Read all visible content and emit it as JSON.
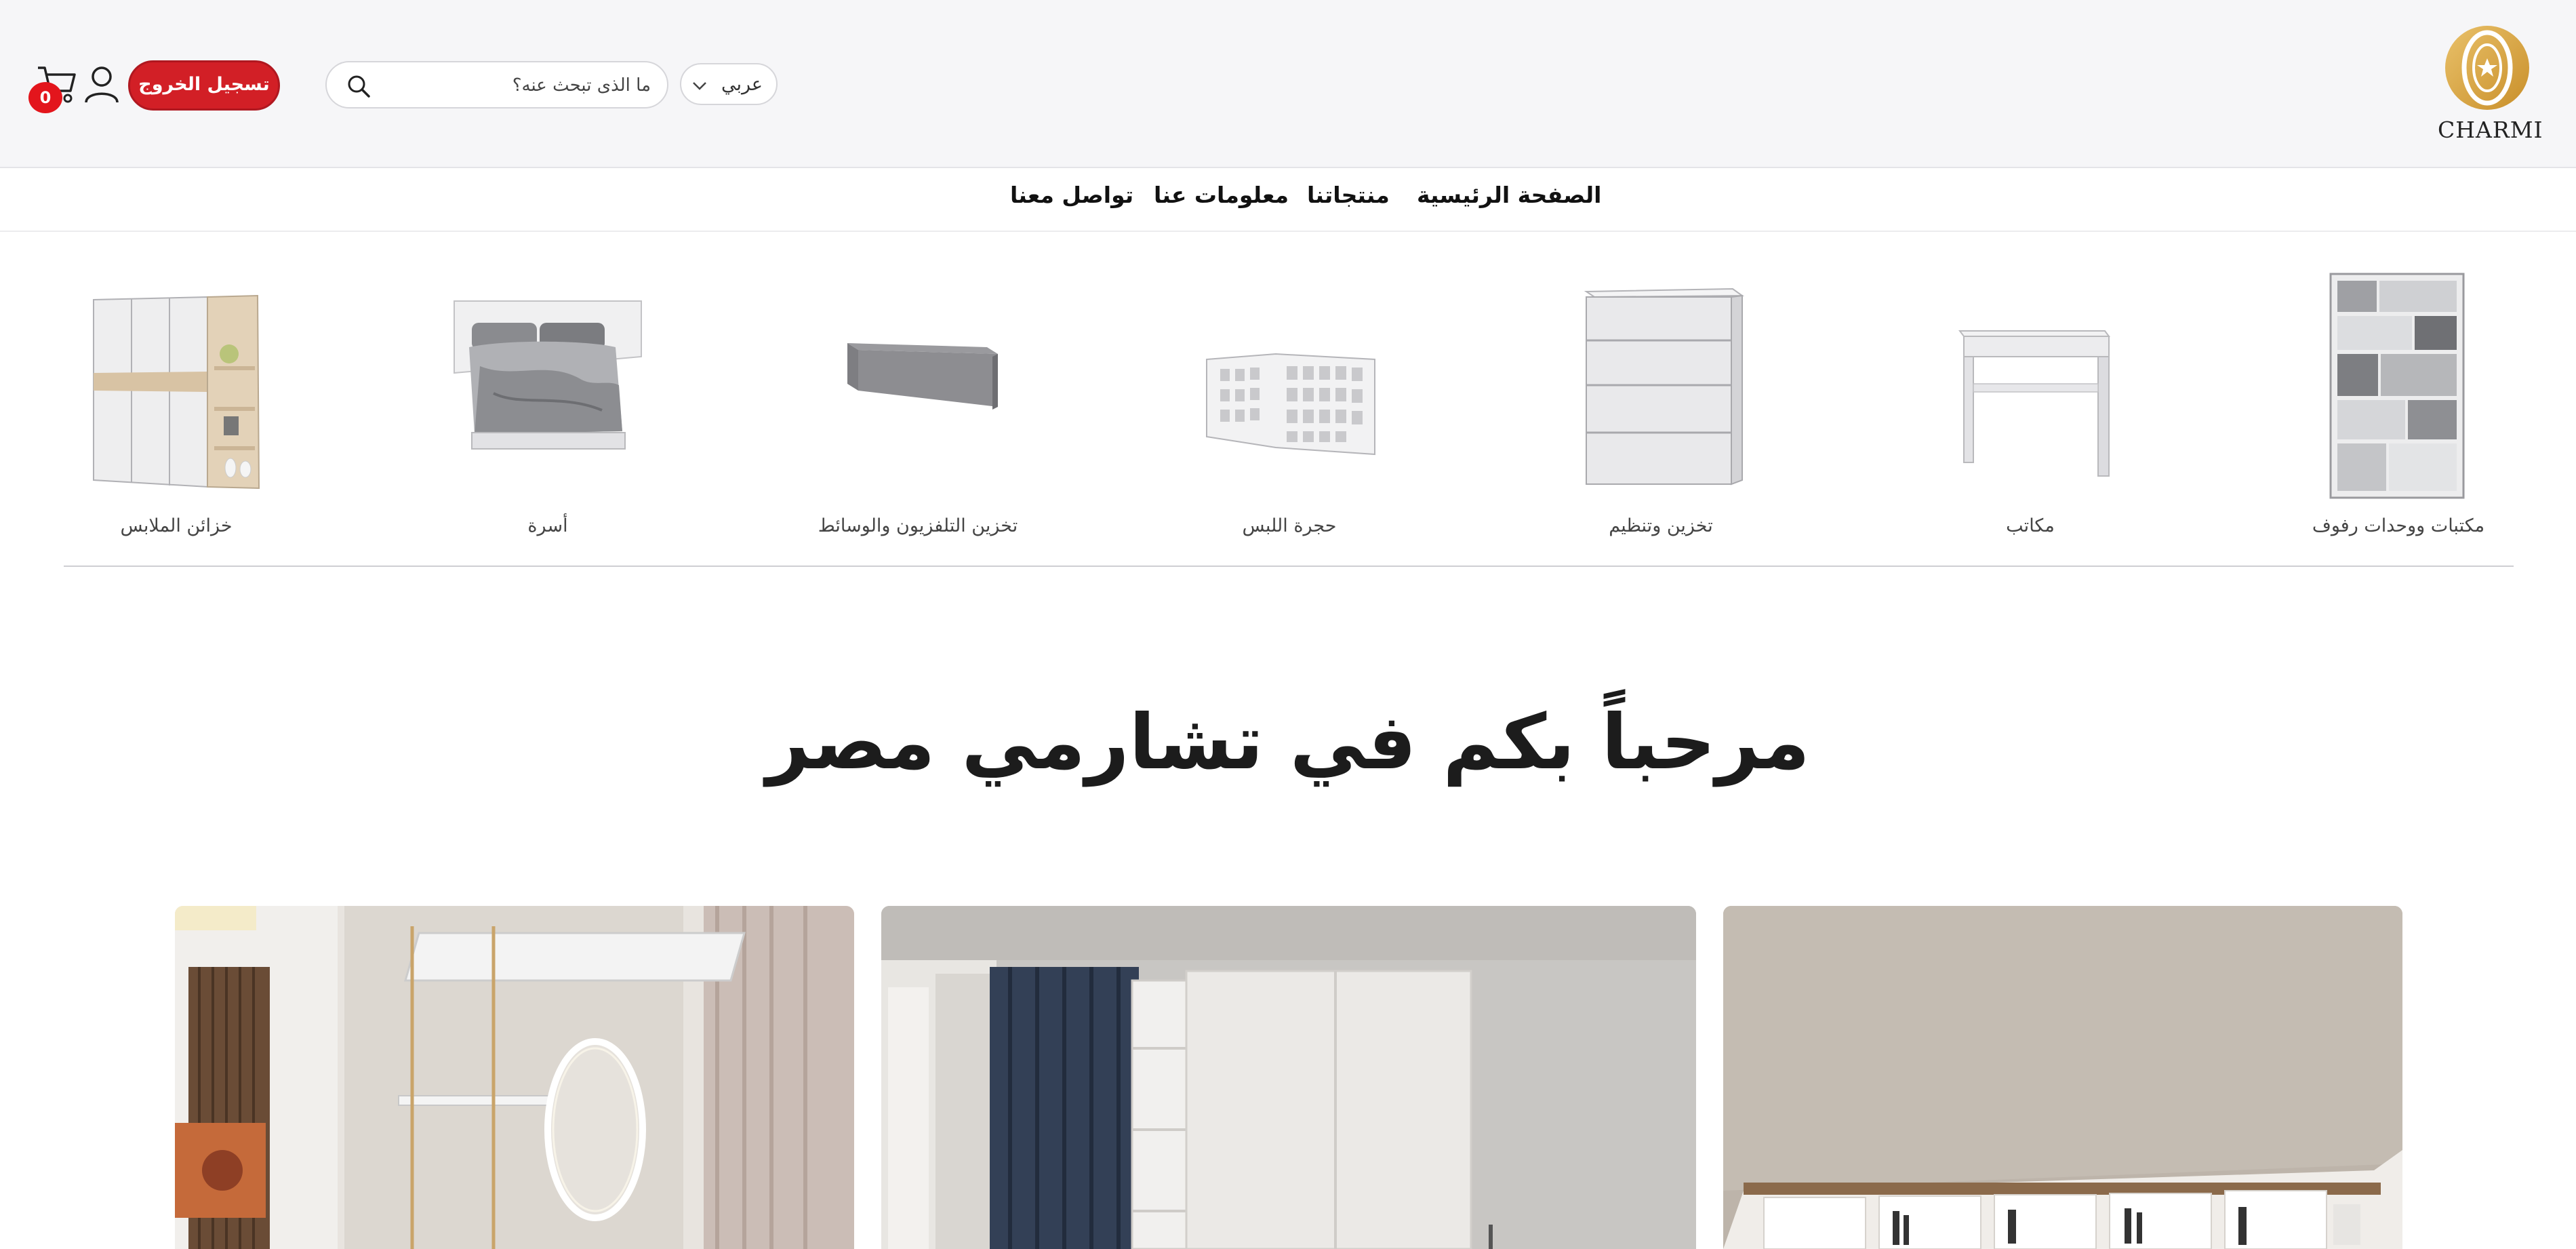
{
  "header": {
    "logo_text": "CHARMI",
    "language": {
      "selected": "عربي"
    },
    "search": {
      "placeholder": "ما الذى تبحث عنه؟",
      "value": ""
    },
    "logout_label": "تسجيل الخروج",
    "cart_count": "0",
    "brand_color": "#d21f26",
    "logo_color": "#d8a33c"
  },
  "nav": {
    "items": [
      {
        "label": "الصفحة الرئيسية"
      },
      {
        "label": "منتجاتنا"
      },
      {
        "label": "معلومات عنا"
      },
      {
        "label": "تواصل معنا"
      }
    ]
  },
  "categories": [
    {
      "label": "مكتبات ووحدات رفوف",
      "icon": "bookcase-image"
    },
    {
      "label": "مكاتب",
      "icon": "desk-image"
    },
    {
      "label": "تخزين وتنظيم",
      "icon": "chest-of-drawers-image"
    },
    {
      "label": "حجرة اللبس",
      "icon": "walk-in-closet-image"
    },
    {
      "label": "تخزين التلفزيون والوسائط",
      "icon": "tv-unit-image"
    },
    {
      "label": "أسرة",
      "icon": "bed-image"
    },
    {
      "label": "خزائن الملابس",
      "icon": "wardrobe-image"
    }
  ],
  "welcome_title": "مرحباً بكم في تشارمي مصر",
  "features": [
    {
      "name": "vanity-room-image"
    },
    {
      "name": "wardrobe-room-image"
    },
    {
      "name": "shelving-room-image"
    }
  ]
}
